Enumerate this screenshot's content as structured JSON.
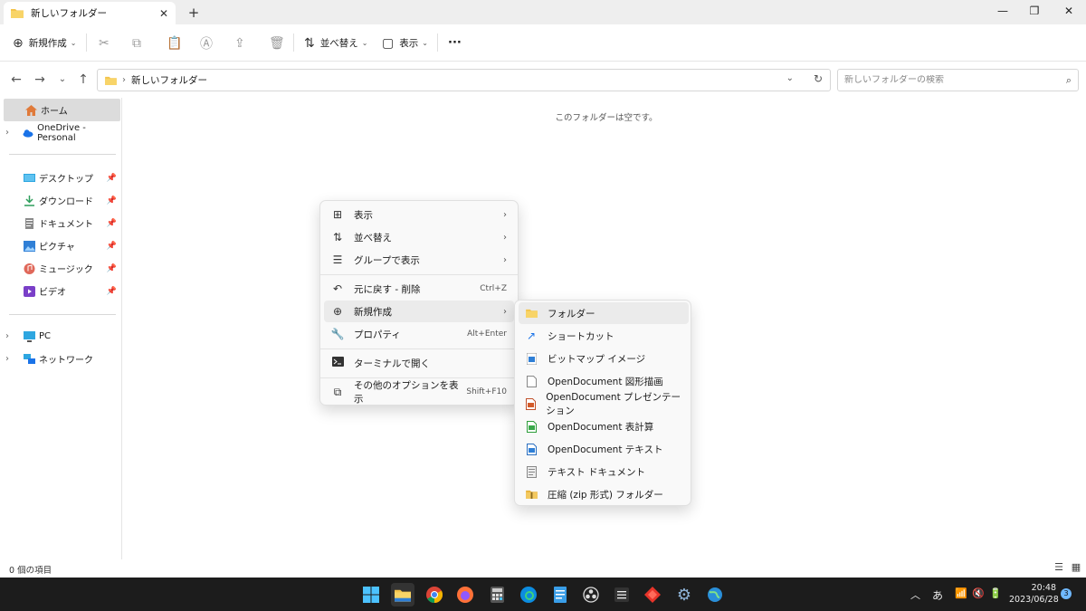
{
  "window": {
    "tab_title": "新しいフォルダー",
    "new_tab": "+",
    "minimize": "—",
    "maximize": "❐",
    "close": "✕"
  },
  "toolbar": {
    "new_label": "新規作成",
    "sort_label": "並べ替え",
    "view_label": "表示",
    "more": "···"
  },
  "address": {
    "path": "新しいフォルダー",
    "separator": "›"
  },
  "search": {
    "placeholder": "新しいフォルダーの検索"
  },
  "nav": {
    "home": "ホーム",
    "onedrive": "OneDrive - Personal",
    "desktop": "デスクトップ",
    "downloads": "ダウンロード",
    "documents": "ドキュメント",
    "pictures": "ピクチャ",
    "music": "ミュージック",
    "videos": "ビデオ",
    "pc": "PC",
    "network": "ネットワーク"
  },
  "content": {
    "empty_message": "このフォルダーは空です。"
  },
  "context_menu": {
    "view": "表示",
    "sort": "並べ替え",
    "group": "グループで表示",
    "undo": "元に戻す - 削除",
    "undo_key": "Ctrl+Z",
    "new": "新規作成",
    "properties": "プロパティ",
    "properties_key": "Alt+Enter",
    "terminal": "ターミナルで開く",
    "more_options": "その他のオプションを表示",
    "more_options_key": "Shift+F10"
  },
  "submenu": {
    "folder": "フォルダー",
    "shortcut": "ショートカット",
    "bitmap": "ビットマップ イメージ",
    "od_draw": "OpenDocument 図形描画",
    "od_present": "OpenDocument プレゼンテーション",
    "od_calc": "OpenDocument 表計算",
    "od_text": "OpenDocument テキスト",
    "text_doc": "テキスト ドキュメント",
    "zip": "圧縮 (zip 形式) フォルダー"
  },
  "status": {
    "item_count": "0 個の項目"
  },
  "taskbar": {
    "ime": "あ",
    "time": "20:48",
    "date": "2023/06/28",
    "notifications": "3"
  }
}
